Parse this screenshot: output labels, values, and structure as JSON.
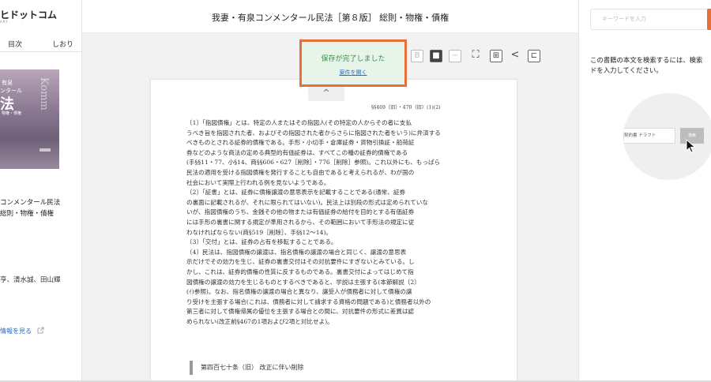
{
  "header": {
    "logo": "ヒドットコム",
    "logo_sub": "ARY",
    "title": "我妻・有泉コンメンタール民法［第８版］ 総則・物権・債権"
  },
  "left_panel": {
    "tabs": [
      "目次",
      "しおり"
    ],
    "cover": {
      "line1": "有泉",
      "line2": "ンタール",
      "line3": "法",
      "line4": "物権・債権",
      "vertical": "Komm"
    },
    "book_title_line1": "コンメンタール民法",
    "book_title_line2": "総則・物権・債権",
    "authors": "亨、清水誠、田山輝",
    "more_info": "情報を見る"
  },
  "toolbar": {
    "buttons": [
      "B",
      "■",
      "−",
      "⛶",
      "⊞",
      "<",
      "⊏"
    ]
  },
  "toast": {
    "message": "保存が完了しました",
    "link": "案件を開く"
  },
  "document": {
    "up_chevron": "^",
    "page_ref": "§§469（旧）・470（旧）(1)(2)",
    "lines": [
      "〔1〕「指図債権」とは、特定の人またはその指図人(その特定の人からその者に支払",
      "うべき旨を指図された者、およびその指図された者からさらに指図された者をいう)に弁済する",
      "べきものとされる証券的債権である。手形・小切手・倉庫証券・貨物引換証・船荷証",
      "券などのような商法の定める典型的有価証券は、すべてこの種の証券的債権である",
      "(手§§11・77、小§14、商§§606・627［削除］・776［削除］参照)。これ以外にも、もっぱら",
      "民法の適用を受ける指図債権を発行することも自由であると考えられるが、わが国の",
      "社会において実際上行われる例を見ないようである。",
      "〔2〕「証書」とは、証券に債権譲渡の意思表示を記載することである(通常、証券",
      "の裏面に記載されるが、それに限られてはいない)。民法上は別段の形式は定められていな",
      "いが、指図債権のうち、金銭その他の物または有価証券の給付を目的とする有価証券",
      "には手形の裏書に関する規定が準用されるから、その範囲において手形法の規定に従",
      "わなければならない(商§519［削除］、手§§12〜14)。",
      "〔3〕「交付」とは、証券の占有を移転することである。",
      "〔4〕民法は、指図債権の譲渡は、指名債権の譲渡の場合と同じく、譲渡の意思表",
      "示だけでその効力を生じ、証券の裏書交付はその対抗要件にすぎないとみている。し",
      "かし、これは、証券的債権の性質に反するものである。裏書交付によってはじめて指",
      "図債権の譲渡の効力を生じるものとするべきであると、学説は主張する(本節解説〔2〕",
      "(ｲ)参照)。なお、指名債権の譲渡の場合と異なり、譲受人が債務者に対して債権の譲",
      "り受けを主張する場合(これは、債務者に対して請求する資格の問題である)と債務者以外の",
      "第三者に対して債権帰属の優位を主張する場合との間に、対抗要件の形式に差異は認",
      "められない(改正前§467の1項および2項と対比せよ)。"
    ],
    "section_head": "第四百七十条（旧） 改正に伴い削除"
  },
  "right_panel": {
    "search_placeholder": "キーワードを入力",
    "help_line1": "この書籍の本文を検索するには、検索",
    "help_line2": "ドを入力してください。",
    "demo_field": "契約書 ドラフト",
    "demo_button": "検索"
  }
}
